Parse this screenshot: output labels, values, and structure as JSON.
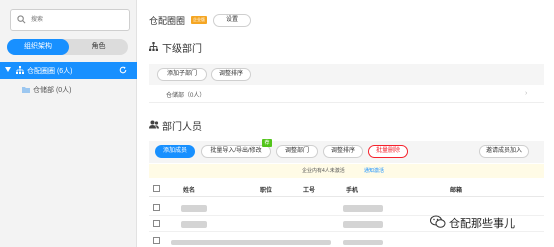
{
  "sidebar": {
    "search_placeholder": "搜索",
    "tabs": [
      "组织架构",
      "角色"
    ],
    "root": {
      "label": "仓配圈圈 (6人)"
    },
    "children": [
      {
        "label": "仓储部 (0人)"
      }
    ]
  },
  "header": {
    "title": "仓配圈圈",
    "badge": "企业版",
    "settings_label": "设置"
  },
  "subdept": {
    "heading": "下级部门",
    "add_label": "添加子部门",
    "sort_label": "调整排序",
    "rows": [
      {
        "name": "仓储部",
        "count": "（0人）"
      }
    ]
  },
  "members": {
    "heading": "部门人员",
    "buttons": {
      "add": "添加成员",
      "import": "批量导入/导出/修改",
      "new_tag": "荐",
      "move": "调整部门",
      "sort": "调整排序",
      "delete": "批量删除",
      "invite": "邀请成员加入"
    },
    "notice": "企业内有4人未激活",
    "notice_link": "通知激活",
    "columns": [
      "姓名",
      "职位",
      "工号",
      "手机",
      "邮箱"
    ],
    "row_count": 4
  },
  "watermark": {
    "text": "仓配那些事儿"
  },
  "colors": {
    "accent": "#1890ff",
    "danger": "#f5222d",
    "badge": "#f5a623",
    "new": "#52c41a"
  }
}
